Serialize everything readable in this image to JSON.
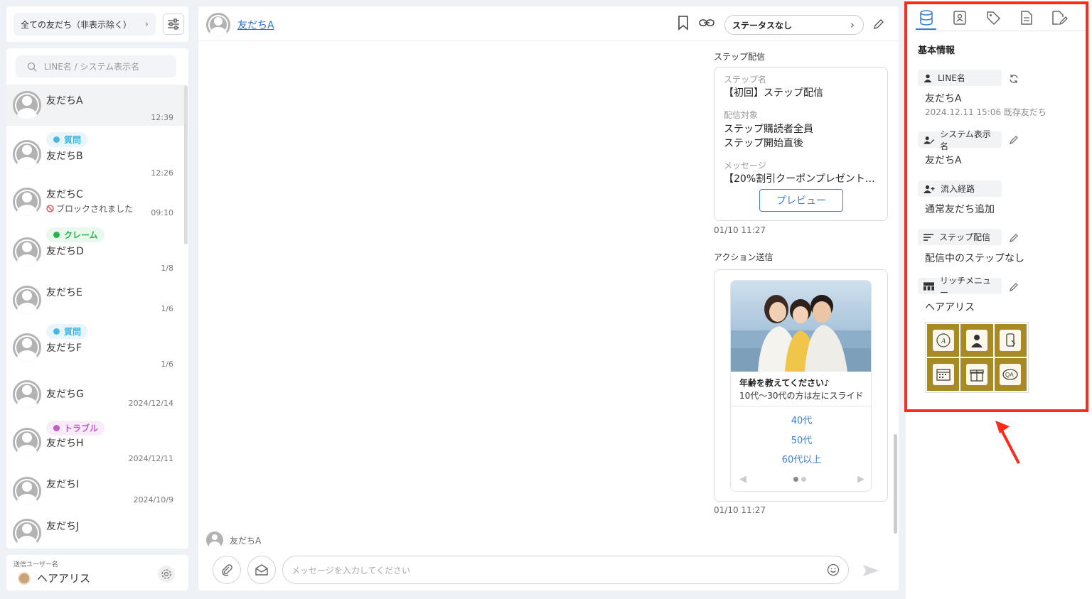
{
  "filter": {
    "label": "全ての友だち（非表示除く）"
  },
  "search": {
    "placeholder": "LINE名 / システム表示名"
  },
  "friends": [
    {
      "name": "友だちA",
      "time": "12:39"
    },
    {
      "name": "友だちB",
      "time": "12:26",
      "tag": "質問"
    },
    {
      "name": "友だちC",
      "time": "09:10",
      "sub": "ブロックされました"
    },
    {
      "name": "友だちD",
      "time": "1/8",
      "tag": "クレーム"
    },
    {
      "name": "友だちE",
      "time": "1/6"
    },
    {
      "name": "友だちF",
      "time": "1/6",
      "tag": "質問"
    },
    {
      "name": "友だちG",
      "time": "2024/12/14"
    },
    {
      "name": "友だちH",
      "time": "2024/12/11",
      "tag": "トラブル"
    },
    {
      "name": "友だちI",
      "time": "2024/10/9"
    },
    {
      "name": "友だちJ",
      "time": ""
    }
  ],
  "sender": {
    "label": "送信ユーザー名",
    "name": "ヘアアリス"
  },
  "chat": {
    "name": "友だちA",
    "status": "ステータスなし",
    "step_label": "ステップ配信",
    "step_card": {
      "name_label": "ステップ名",
      "name_value": "【初回】ステップ配信",
      "target_label": "配信対象",
      "target_value_1": "ステップ購読者全員",
      "target_value_2": "ステップ開始直後",
      "message_label": "メッセージ",
      "message_value": "【20%割引クーポンプレゼント…",
      "preview": "プレビュー"
    },
    "step_time": "01/10 11:27",
    "action_label": "アクション送信",
    "action_card": {
      "title": "年齢を教えてください♪",
      "subtitle": "10代～30代の方は左にスライド",
      "options": [
        "40代",
        "50代",
        "60代以上"
      ]
    },
    "action_time": "01/10 11:27",
    "sender_name": "友だちA",
    "input_placeholder": "メッセージを入力してください"
  },
  "info": {
    "title": "基本情報",
    "line_name_label": "LINE名",
    "line_name_value": "友だちA",
    "line_name_sub": "2024.12.11 15:06 既存友だち",
    "display_name_label": "システム表示名",
    "display_name_value": "友だちA",
    "source_label": "流入経路",
    "source_value": "通常友だち追加",
    "step_label": "ステップ配信",
    "step_value": "配信中のステップなし",
    "richmenu_label": "リッチメニュー",
    "richmenu_value": "ヘアアリス",
    "richmenu_cells": [
      "ALICEとは？",
      "スタイリスト",
      "メニュー",
      "ご予約",
      "ポイント貯める",
      "よくある質問"
    ]
  },
  "colors": {
    "accent": "#3b7fd6",
    "highlight": "#ff2a1a",
    "tag_question": "#46b8e0",
    "tag_claim": "#26b14a",
    "tag_trouble": "#c35bc9"
  }
}
